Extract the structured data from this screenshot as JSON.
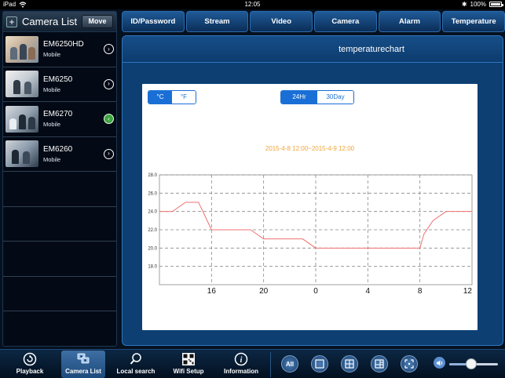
{
  "status_bar": {
    "device": "iPad",
    "time": "12:05",
    "battery": "100%"
  },
  "camera_list": {
    "title": "Camera List",
    "move_label": "Move",
    "cameras": [
      {
        "name": "EM6250HD",
        "type": "Mobile",
        "selected": false
      },
      {
        "name": "EM6250",
        "type": "Mobile",
        "selected": false
      },
      {
        "name": "EM6270",
        "type": "Mobile",
        "selected": true
      },
      {
        "name": "EM6260",
        "type": "Mobile",
        "selected": false
      }
    ]
  },
  "tabs": [
    "ID/Password",
    "Stream",
    "Video",
    "Camera",
    "Alarm",
    "Temperature"
  ],
  "panel": {
    "title": "temperaturechart"
  },
  "unit_toggle": {
    "options": [
      "°C",
      "°F"
    ],
    "selected": "°C"
  },
  "range_toggle": {
    "options": [
      "24Hr",
      "30Day"
    ],
    "selected": "24Hr"
  },
  "chart_data": {
    "type": "line",
    "title": "2015-4-8 12:00~2015-4-9 12:00",
    "x_tick_labels": [
      "16",
      "20",
      "0",
      "4",
      "8",
      "12"
    ],
    "x_hours": [
      12,
      13,
      14,
      15,
      16,
      17,
      18,
      19,
      20,
      21,
      22,
      23,
      24,
      25,
      26,
      27,
      28,
      29,
      30,
      31,
      32,
      33,
      34,
      35,
      36
    ],
    "xlim": [
      12,
      36
    ],
    "y_ticks": [
      "28.0",
      "26.0",
      "24.0",
      "22.0",
      "20.0",
      "18.0"
    ],
    "ylim": [
      16,
      28
    ],
    "series": [
      {
        "color": "#f07070",
        "x": [
          12,
          13,
          14,
          15,
          15.5,
          16,
          19,
          20,
          21,
          22,
          23,
          24,
          25,
          32,
          32.3,
          33,
          34,
          35,
          36
        ],
        "y": [
          24,
          24,
          25,
          25,
          23.5,
          22,
          22,
          21,
          21,
          21,
          21,
          20,
          20,
          20,
          21.5,
          23,
          24,
          24,
          24
        ]
      }
    ],
    "grid": true
  },
  "bottom_nav": [
    {
      "label": "Playback",
      "icon": "playback-icon",
      "active": false
    },
    {
      "label": "Camera List",
      "icon": "camera-list-icon",
      "active": true
    },
    {
      "label": "Local search",
      "icon": "search-icon",
      "active": false
    },
    {
      "label": "Wifi Setup",
      "icon": "qr-code-icon",
      "active": false
    },
    {
      "label": "Information",
      "icon": "info-icon",
      "active": false
    }
  ],
  "view_buttons": [
    {
      "label": "All",
      "icon": "all-view-icon"
    },
    {
      "label": "",
      "icon": "single-view-icon"
    },
    {
      "label": "",
      "icon": "quad-view-icon"
    },
    {
      "label": "",
      "icon": "multi-view-icon"
    },
    {
      "label": "",
      "icon": "fullscreen-icon"
    }
  ],
  "volume": {
    "level": 0.45
  }
}
